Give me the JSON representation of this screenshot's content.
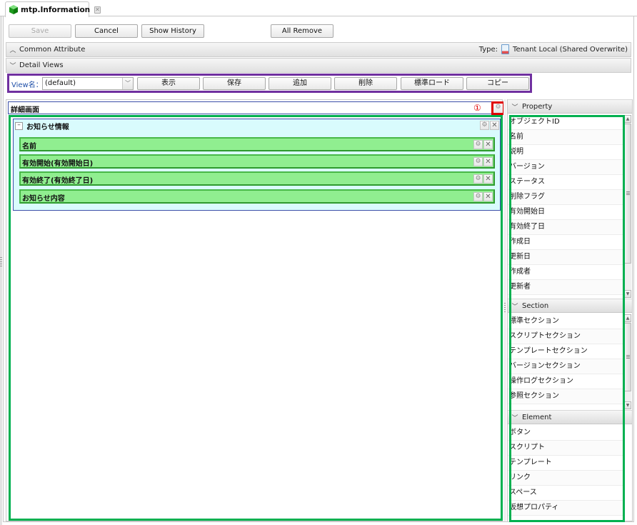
{
  "tab": {
    "title": "mtp.Information",
    "close_glyph": "✕",
    "icon": "green-cube-icon"
  },
  "toolbar": {
    "save_label": "Save",
    "cancel_label": "Cancel",
    "show_history_label": "Show History",
    "all_remove_label": "All Remove"
  },
  "common_attribute": {
    "label": "Common Attribute",
    "expanded": false,
    "type_label": "Type:",
    "type_value": "Tenant Local (Shared Overwrite)"
  },
  "detail_views": {
    "label": "Detail Views",
    "expanded": true
  },
  "view_bar": {
    "view_name_label": "View名：",
    "selected_view": "(default)",
    "buttons": [
      "表示",
      "保存",
      "追加",
      "削除",
      "標準ロード",
      "コピー"
    ]
  },
  "canvas": {
    "title": "詳細画面",
    "marker": "①",
    "section": {
      "title": "お知らせ情報",
      "collapse_glyph": "–",
      "properties": [
        "名前",
        "有効開始(有効開始日)",
        "有効終了(有効終了日)",
        "お知らせ内容"
      ]
    }
  },
  "icons": {
    "gear": "⚙",
    "close": "✕",
    "chevron_up": "︿",
    "chevron_down": "﹀",
    "scroll_up": "▲",
    "scroll_down": "▼"
  },
  "palette": {
    "property": {
      "label": "Property",
      "items": [
        "オブジェクトID",
        "名前",
        "説明",
        "バージョン",
        "ステータス",
        "削除フラグ",
        "有効開始日",
        "有効終了日",
        "作成日",
        "更新日",
        "作成者",
        "更新者"
      ]
    },
    "section": {
      "label": "Section",
      "items": [
        "標準セクション",
        "スクリプトセクション",
        "テンプレートセクション",
        "バージョンセクション",
        "操作ログセクション",
        "参照セクション"
      ]
    },
    "element": {
      "label": "Element",
      "items": [
        "ボタン",
        "スクリプト",
        "テンプレート",
        "リンク",
        "スペース",
        "仮想プロパティ"
      ]
    }
  }
}
